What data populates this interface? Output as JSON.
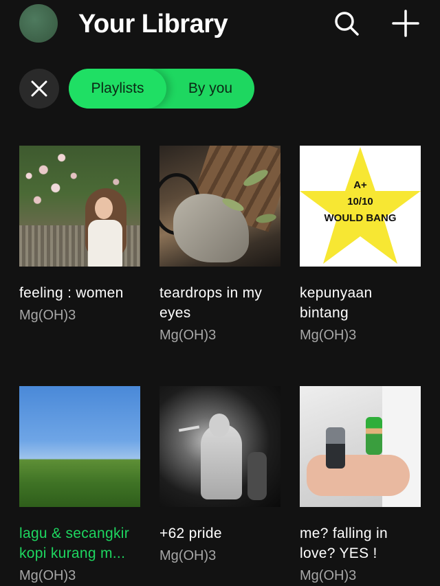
{
  "header": {
    "title": "Your Library",
    "search_icon": "search-icon",
    "add_icon": "plus-icon"
  },
  "filters": {
    "clear_icon": "close-icon",
    "primary": "Playlists",
    "secondary": "By you"
  },
  "playlists": [
    {
      "title": "feeling : women",
      "owner": "Mg(OH)3",
      "active": false,
      "cover": "girl-in-garden-photo"
    },
    {
      "title": "teardrops in my eyes",
      "owner": "Mg(OH)3",
      "active": false,
      "cover": "wood-and-plants-photo"
    },
    {
      "title": "kepunyaan bintang",
      "owner": "Mg(OH)3",
      "active": false,
      "cover": "yellow-star"
    },
    {
      "title": "lagu & secangkir kopi kurang m...",
      "owner": "Mg(OH)3",
      "active": true,
      "cover": "green-field-photo"
    },
    {
      "title": "+62 pride",
      "owner": "Mg(OH)3",
      "active": false,
      "cover": "singer-on-stage-photo"
    },
    {
      "title": "me? falling in love? YES !",
      "owner": "Mg(OH)3",
      "active": false,
      "cover": "lego-figures-photo"
    }
  ],
  "star_cover": {
    "line1": "A+",
    "line2": "10/10",
    "line3": "WOULD BANG"
  },
  "colors": {
    "background": "#121212",
    "accent": "#1ed760",
    "secondary_text": "#a7a7a7"
  }
}
